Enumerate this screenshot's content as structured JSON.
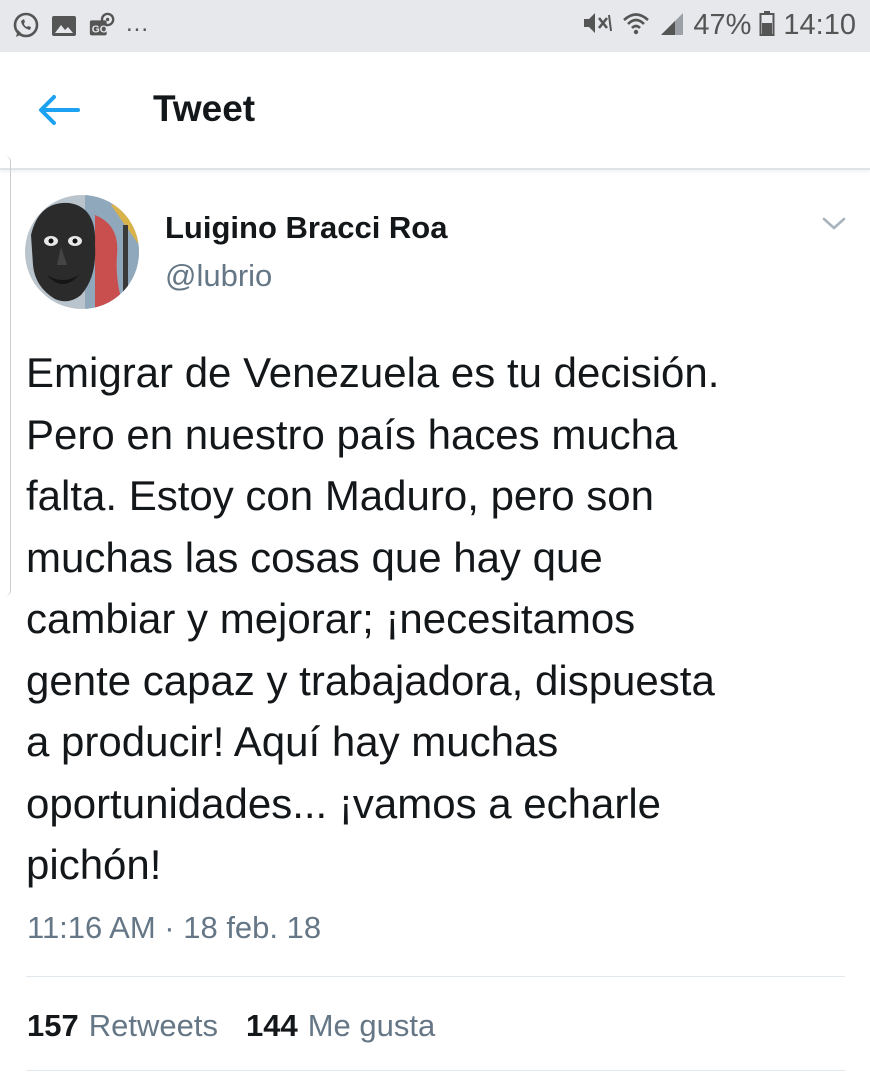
{
  "status_bar": {
    "icons_left": [
      "whatsapp-icon",
      "gallery-icon",
      "nav-icon"
    ],
    "overflow": "...",
    "battery_percent": "47%",
    "time": "14:10"
  },
  "header": {
    "title": "Tweet"
  },
  "tweet": {
    "author_name": "Luigino Bracci Roa",
    "handle": "@lubrio",
    "text": "Emigrar de Venezuela es tu decisión.\nPero en nuestro país haces mucha\nfalta. Estoy con Maduro, pero son\nmuchas las cosas que hay que\ncambiar y mejorar; ¡necesitamos\ngente capaz y trabajadora, dispuesta\na producir! Aquí hay muchas\noportunidades... ¡vamos a echarle\npichón!",
    "timestamp": "11:16 AM · 18 feb. 18",
    "retweets_count": "157",
    "retweets_label": "Retweets",
    "likes_count": "144",
    "likes_label": "Me gusta"
  },
  "colors": {
    "accent": "#1da1f2",
    "text": "#14171a",
    "secondary": "#657786",
    "status_bar_bg": "#e7e8ec"
  }
}
